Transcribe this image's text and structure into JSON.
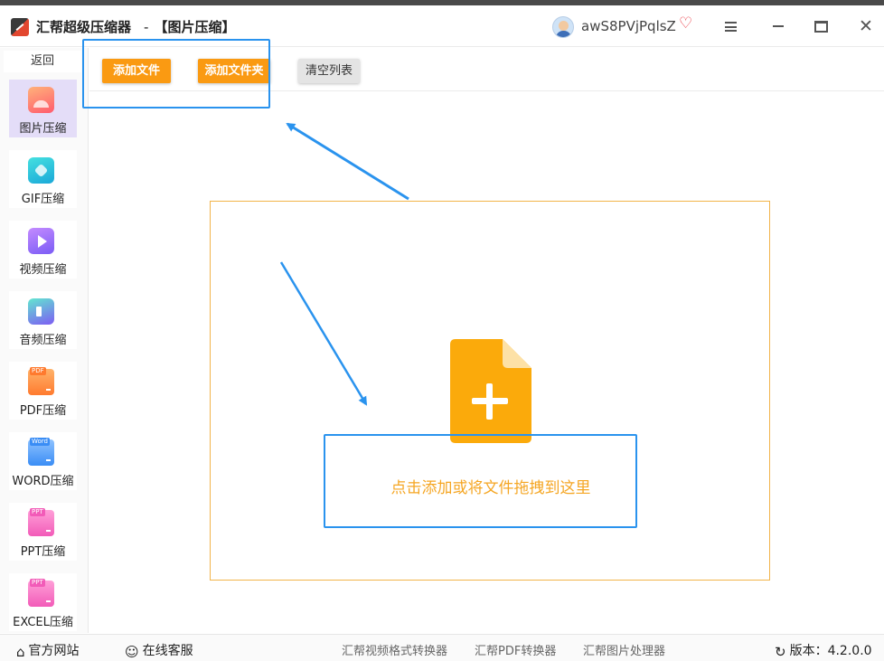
{
  "window": {
    "app_title": "汇帮超级压缩器",
    "page_title": "【图片压缩】",
    "username": "awS8PVjPqlsZ",
    "controls": [
      "menu",
      "minimize",
      "maximize",
      "close"
    ]
  },
  "sidebar": {
    "back_label": "返回",
    "items": [
      {
        "label": "图片压缩",
        "icon": "image-icon",
        "active": true
      },
      {
        "label": "GIF压缩",
        "icon": "gif-icon",
        "active": false
      },
      {
        "label": "视频压缩",
        "icon": "video-icon",
        "active": false
      },
      {
        "label": "音频压缩",
        "icon": "audio-icon",
        "active": false
      },
      {
        "label": "PDF压缩",
        "icon": "pdf-icon",
        "badge": "PDF",
        "active": false
      },
      {
        "label": "WORD压缩",
        "icon": "word-icon",
        "badge": "Word",
        "active": false
      },
      {
        "label": "PPT压缩",
        "icon": "ppt-icon",
        "badge": "PPT",
        "active": false
      },
      {
        "label": "EXCEL压缩",
        "icon": "excel-icon",
        "badge": "PPT",
        "active": false
      }
    ]
  },
  "toolbar": {
    "add_file_label": "添加文件",
    "add_folder_label": "添加文件夹",
    "clear_list_label": "清空列表"
  },
  "dropzone": {
    "hint": "点击添加或将文件拖拽到这里",
    "icon": "file-add-icon"
  },
  "statusbar": {
    "home_label": "官方网站",
    "support_label": "在线客服",
    "tools": [
      "汇帮视频格式转换器",
      "汇帮PDF转换器",
      "汇帮图片处理器"
    ],
    "version_label": "版本：4.2.0.0"
  },
  "colors": {
    "accent_orange": "#fa9a12",
    "annotation_blue": "#2a93ee",
    "active_nav": "#e4ddf8",
    "hint_text": "#f5a623"
  }
}
